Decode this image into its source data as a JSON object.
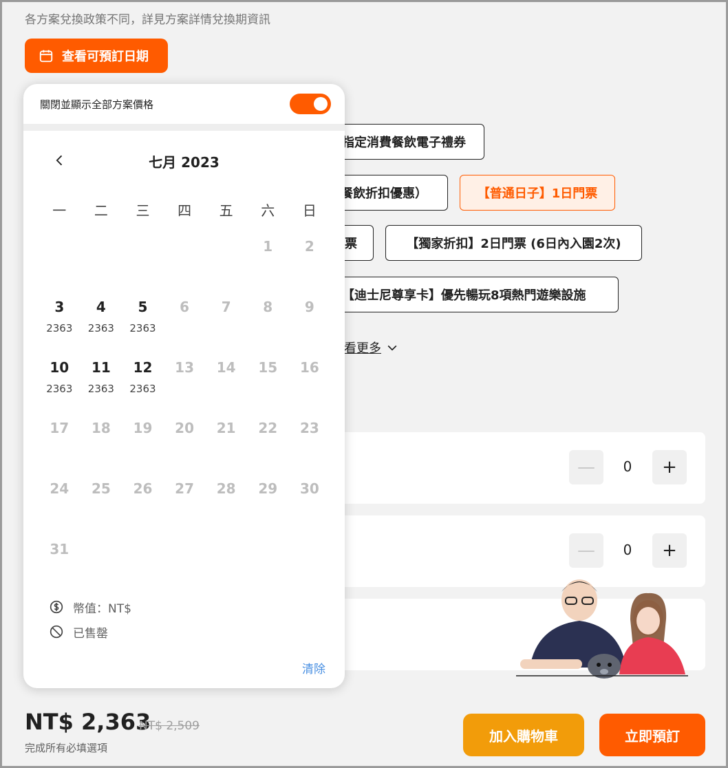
{
  "header": {
    "policy_note": "各方案兌換政策不同，詳見方案詳情兌換期資訊",
    "date_button_label": "查看可預訂日期"
  },
  "options": {
    "chips": [
      "指定消費餐飲電子禮券",
      "餐飲折扣優惠）",
      "【普通日子】1日門票",
      "票",
      "【獨家折扣】2日門票 (6日內入園2次)",
      "【迪士尼尊享卡】優先暢玩8項熱門遊樂設施"
    ],
    "selected_chip": "【普通日子】1日門票",
    "see_more_label": "看更多"
  },
  "quantities": [
    {
      "value": "0",
      "minus": "—",
      "plus": "+"
    },
    {
      "value": "0",
      "minus": "—",
      "plus": "+"
    }
  ],
  "popup": {
    "toggle_label": "關閉並顯示全部方案價格",
    "toggle_on": true,
    "month_title": "七月 2023",
    "weekdays": [
      "一",
      "二",
      "三",
      "四",
      "五",
      "六",
      "日"
    ],
    "days": [
      {
        "n": "",
        "price": "",
        "available": false
      },
      {
        "n": "",
        "price": "",
        "available": false
      },
      {
        "n": "",
        "price": "",
        "available": false
      },
      {
        "n": "",
        "price": "",
        "available": false
      },
      {
        "n": "",
        "price": "",
        "available": false
      },
      {
        "n": "1",
        "price": "",
        "available": false
      },
      {
        "n": "2",
        "price": "",
        "available": false
      },
      {
        "n": "3",
        "price": "2363",
        "available": true
      },
      {
        "n": "4",
        "price": "2363",
        "available": true
      },
      {
        "n": "5",
        "price": "2363",
        "available": true
      },
      {
        "n": "6",
        "price": "",
        "available": false
      },
      {
        "n": "7",
        "price": "",
        "available": false
      },
      {
        "n": "8",
        "price": "",
        "available": false
      },
      {
        "n": "9",
        "price": "",
        "available": false
      },
      {
        "n": "10",
        "price": "2363",
        "available": true
      },
      {
        "n": "11",
        "price": "2363",
        "available": true
      },
      {
        "n": "12",
        "price": "2363",
        "available": true
      },
      {
        "n": "13",
        "price": "",
        "available": false
      },
      {
        "n": "14",
        "price": "",
        "available": false
      },
      {
        "n": "15",
        "price": "",
        "available": false
      },
      {
        "n": "16",
        "price": "",
        "available": false
      },
      {
        "n": "17",
        "price": "",
        "available": false
      },
      {
        "n": "18",
        "price": "",
        "available": false
      },
      {
        "n": "19",
        "price": "",
        "available": false
      },
      {
        "n": "20",
        "price": "",
        "available": false
      },
      {
        "n": "21",
        "price": "",
        "available": false
      },
      {
        "n": "22",
        "price": "",
        "available": false
      },
      {
        "n": "23",
        "price": "",
        "available": false
      },
      {
        "n": "24",
        "price": "",
        "available": false
      },
      {
        "n": "25",
        "price": "",
        "available": false
      },
      {
        "n": "26",
        "price": "",
        "available": false
      },
      {
        "n": "27",
        "price": "",
        "available": false
      },
      {
        "n": "28",
        "price": "",
        "available": false
      },
      {
        "n": "29",
        "price": "",
        "available": false
      },
      {
        "n": "30",
        "price": "",
        "available": false
      },
      {
        "n": "31",
        "price": "",
        "available": false
      }
    ],
    "legend_currency": "幣值：NT$",
    "legend_sold_out": "已售罄",
    "clear_label": "清除"
  },
  "footer": {
    "price": "NT$ 2,363",
    "original_price": "NT$ 2,509",
    "note": "完成所有必填選項",
    "cart_label": "加入購物車",
    "book_label": "立即預訂"
  },
  "colors": {
    "accent": "#ff5b00",
    "cart": "#f29c0a",
    "link": "#4a90e2"
  }
}
